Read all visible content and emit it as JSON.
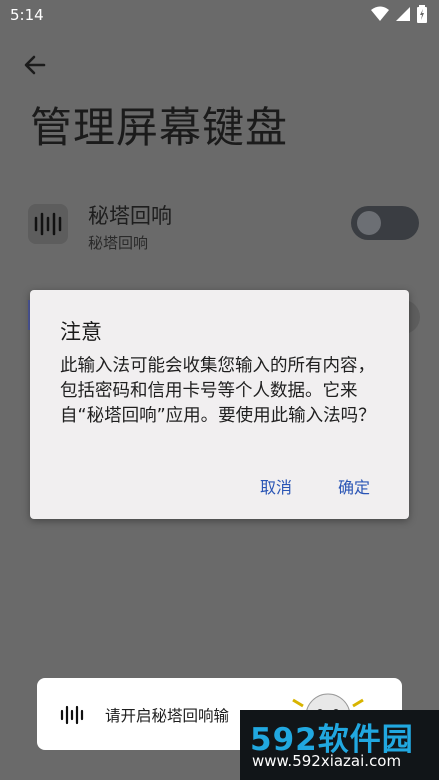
{
  "status_bar": {
    "time": "5:14",
    "wifi_icon": "wifi-icon",
    "signal_icon": "signal-icon",
    "battery_icon": "battery-icon"
  },
  "header": {
    "back_icon": "arrow-left-icon",
    "title": "管理屏幕键盘"
  },
  "keyboard_item": {
    "name": "秘塔回响",
    "subtitle": "秘塔回响",
    "icon": "sound-wave-icon",
    "enabled": false
  },
  "dialog": {
    "title": "注意",
    "message": "此输入法可能会收集您输入的所有内容，包括密码和信用卡号等个人数据。它来自“秘塔回响”应用。要使用此输入法吗？",
    "cancel_label": "取消",
    "ok_label": "确定"
  },
  "toast": {
    "text": "请开启秘塔回响输",
    "icon": "sound-wave-icon"
  },
  "watermark": {
    "brand": "592软件园",
    "url": "www.592xiazai.com"
  },
  "colors": {
    "accent": "#2a55b5",
    "scrim": "#6a6a6a",
    "dialog_bg": "#f1eff0",
    "watermark_blue": "#21a8e0"
  }
}
